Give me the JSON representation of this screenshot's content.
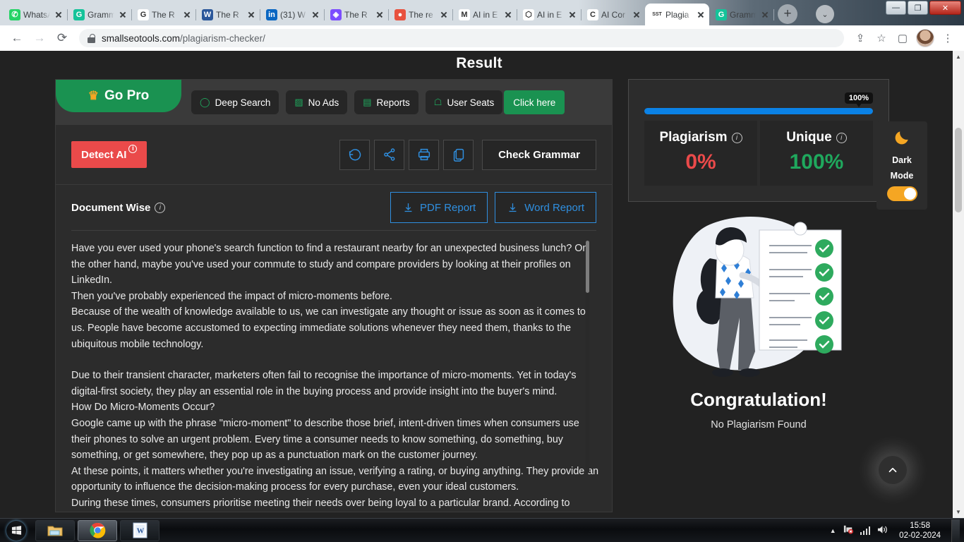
{
  "browser": {
    "tabs": [
      {
        "title": "WhatsApp",
        "favicon": "whatsapp-icon",
        "color": "#25D366",
        "glyph": "✆",
        "active": false
      },
      {
        "title": "Grammarly",
        "favicon": "grammarly-icon",
        "color": "#15C39A",
        "glyph": "G",
        "active": false
      },
      {
        "title": "The R",
        "favicon": "google-icon",
        "color": "#ffffff",
        "glyph": "G",
        "active": false
      },
      {
        "title": "The R",
        "favicon": "word-icon",
        "color": "#2b579a",
        "glyph": "W",
        "active": false
      },
      {
        "title": "(31) W",
        "favicon": "linkedin-icon",
        "color": "#0a66c2",
        "glyph": "in",
        "active": false
      },
      {
        "title": "The R",
        "favicon": "gem-icon",
        "color": "#7c4dff",
        "glyph": "◈",
        "active": false
      },
      {
        "title": "The re",
        "favicon": "chat-icon",
        "color": "#e8523f",
        "glyph": "●",
        "active": false
      },
      {
        "title": "AI in E",
        "favicon": "medium-icon",
        "color": "#ffffff",
        "glyph": "M",
        "active": false
      },
      {
        "title": "AI in E",
        "favicon": "hex-icon",
        "color": "#ffffff",
        "glyph": "⬡",
        "active": false
      },
      {
        "title": "AI Cor",
        "favicon": "copyleaks-icon",
        "color": "#ffffff",
        "glyph": "C",
        "active": false
      },
      {
        "title": "Plagia",
        "favicon": "sst-icon",
        "color": "#ffffff",
        "glyph": "SST",
        "active": true
      },
      {
        "title": "Gramm",
        "favicon": "grammarly-icon",
        "color": "#15C39A",
        "glyph": "G",
        "active": false
      }
    ],
    "new_tab_label": "+",
    "tab_search_label": "⌄",
    "window_controls": {
      "minimize": "—",
      "maximize": "❐",
      "close": "✕"
    },
    "toolbar": {
      "back": "←",
      "forward": "→",
      "reload": "⟳",
      "url_domain": "smallseotools.com",
      "url_path": "/plagiarism-checker/",
      "share": "⇪",
      "bookmark": "☆",
      "sidepanel": "▢",
      "menu": "⋮"
    }
  },
  "page": {
    "title": "Result",
    "pro": {
      "go_pro_label": "Go Pro",
      "crown": "♛",
      "features": [
        {
          "label": "Deep Search",
          "icon": "magnifier-icon",
          "glyph": "◯"
        },
        {
          "label": "No Ads",
          "icon": "no-ads-icon",
          "glyph": "▨"
        },
        {
          "label": "Reports",
          "icon": "report-icon",
          "glyph": "▤"
        },
        {
          "label": "User Seats",
          "icon": "user-icon",
          "glyph": "☖"
        }
      ],
      "cta_label": "Click here"
    },
    "actions": {
      "detect_ai_label": "Detect AI",
      "info_glyph": "i",
      "icons": [
        {
          "name": "rewrite-icon",
          "glyph": "↺"
        },
        {
          "name": "share-icon",
          "glyph": "⋖"
        },
        {
          "name": "print-icon",
          "glyph": "⎙"
        },
        {
          "name": "copy-icon",
          "glyph": "❐"
        }
      ],
      "check_grammar_label": "Check Grammar"
    },
    "document": {
      "wise_label": "Document Wise",
      "pdf_report_label": "PDF Report",
      "word_report_label": "Word Report",
      "download_glyph": "↓",
      "paragraphs": [
        "Have you ever used your phone's search function to find a restaurant nearby for an unexpected business lunch? On the other hand, maybe you've used your commute to study and compare providers by looking at their profiles on LinkedIn.",
        "Then you've probably experienced the impact of micro-moments before.",
        "Because of the wealth of knowledge available to us, we can investigate any thought or issue as soon as it comes to us. People have become accustomed to expecting immediate solutions whenever they need them, thanks to the ubiquitous mobile technology.",
        "Due to their transient character, marketers often fail to recognise the importance of micro-moments. Yet in today's digital-first society, they play an essential role in the buying process and provide insight into the buyer's mind.",
        "How Do Micro-Moments Occur?",
        "Google came up with the phrase \"micro-moment\" to describe those brief, intent-driven times when consumers use their phones to solve an urgent problem. Every time a consumer needs to know something, do something, buy something, or get somewhere, they pop up as a punctuation mark on the customer journey.",
        "At these points, it matters whether you're investigating an issue, verifying a rating, or buying anything. They provide an opportunity to influence the decision-making process for every purchase, even your ideal customers.",
        "During these times, consumers prioritise meeting their needs over being loyal to a particular brand. According to"
      ]
    },
    "score": {
      "bubble_label": "100%",
      "progress_percent": 100,
      "plagiarism_label": "Plagiarism",
      "plagiarism_value": "0%",
      "unique_label": "Unique",
      "unique_value": "100%",
      "plagiarism_color": "#ea4a4a",
      "unique_color": "#1fa85d",
      "progress_color": "#0b82e6"
    },
    "result": {
      "heading": "Congratulation!",
      "subheading": "No Plagiarism Found"
    },
    "dark_mode": {
      "moon_glyph": "🌙",
      "line1": "Dark",
      "line2": "Mode",
      "enabled": true,
      "accent": "#f5a623"
    },
    "scroll_top_glyph": "⌃"
  },
  "taskbar": {
    "start_label": "⊞",
    "items": [
      {
        "name": "file-explorer-icon",
        "glyph": "🗂"
      },
      {
        "name": "chrome-icon",
        "glyph": "◉"
      },
      {
        "name": "word-icon",
        "glyph": "W"
      }
    ],
    "tray": {
      "expand_glyph": "▲",
      "network_glyph": "🖧",
      "volume_glyph": "🔊",
      "time": "15:58",
      "date": "02-02-2024"
    }
  }
}
